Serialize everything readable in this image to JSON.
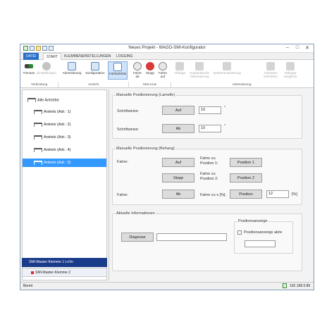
{
  "window": {
    "title": "Neues Projekt - WAGO-SMI-Konfigurator",
    "minimize": "–",
    "maximize": "□",
    "close": "✕"
  },
  "tabs": {
    "file": "DATEI",
    "start": "START",
    "terminal": "KLEMMENEINSTELLUNGEN",
    "logging": "LOGGING"
  },
  "ribbon": {
    "trennen": "Trennen",
    "einstellungen": "Einstellungen",
    "adressierung": "Adressierung",
    "konfiguration": "Konfiguration",
    "fahrbefehle": "Fahrbefehle",
    "fahre_ab_1": "Fahre",
    "fahre_ab_2": "ab",
    "stopp": "Stopp",
    "fahre_auf_1": "Fahre",
    "fahre_auf_2": "auf",
    "abfrage": "Abfrage",
    "auto_addr_1": "Automatische",
    "auto_addr_2": "Adressierung",
    "systemerweiterung": "Systemerweiterung",
    "adressen_1": "Adressen",
    "adressen_2": "schreiben",
    "abfrage_vergleich_1": "Abfrage/",
    "abfrage_vergleich_2": "Vergleich",
    "groups": {
      "verbindung": "Verbindung",
      "ansicht": "Ansicht",
      "smi_linie": "SMI-Linie",
      "adressierung": "Adressierung"
    }
  },
  "tree": {
    "root": "Alle Antriebe",
    "items": [
      "Antrieb (Adr.: 1)",
      "Antrieb (Adr.: 2)",
      "Antrieb (Adr.: 3)",
      "Antrieb (Adr.: 4)",
      "Antrieb (Adr.: 5)"
    ]
  },
  "nav": {
    "master1": "SMI-Master-Klemme 1 LoVo",
    "master2": "SMI-Master-Klemme 2"
  },
  "lamelle": {
    "title": "Manuelle Positionierung (Lamelle)",
    "schritt1": "Schrittweise:",
    "auf": "Auf",
    "value1": "10",
    "unit1": "°",
    "schritt2": "Schrittweise:",
    "ab": "Ab",
    "value2": "10",
    "unit2": "°"
  },
  "behang": {
    "title": "Manuelle Positionierung (Behang)",
    "fahre1": "Fahre:",
    "auf": "Auf",
    "fahre_zu_pos1_a": "Fahre zu",
    "fahre_zu_pos1_b": "Position 1:",
    "position1": "Position 1",
    "stopp": "Stopp",
    "fahre_zu_pos2_a": "Fahre zu",
    "fahre_zu_pos2_b": "Position 2:",
    "position2": "Position 2",
    "fahre2": "Fahre:",
    "ab": "Ab",
    "fahre_zu_x": "Fahre zu x [%]:",
    "position": "Position",
    "value": "12",
    "unit": "[%]"
  },
  "info": {
    "title": "Aktuelle Informationen",
    "diagnose": "Diagnose",
    "diag_value": "",
    "posanzeige_title": "Positionsanzeige",
    "posanzeige_check": "Positionsanzeige aktiv",
    "pos_value": ""
  },
  "status": {
    "left": "Bereit",
    "ip": "192.168.0.89"
  }
}
